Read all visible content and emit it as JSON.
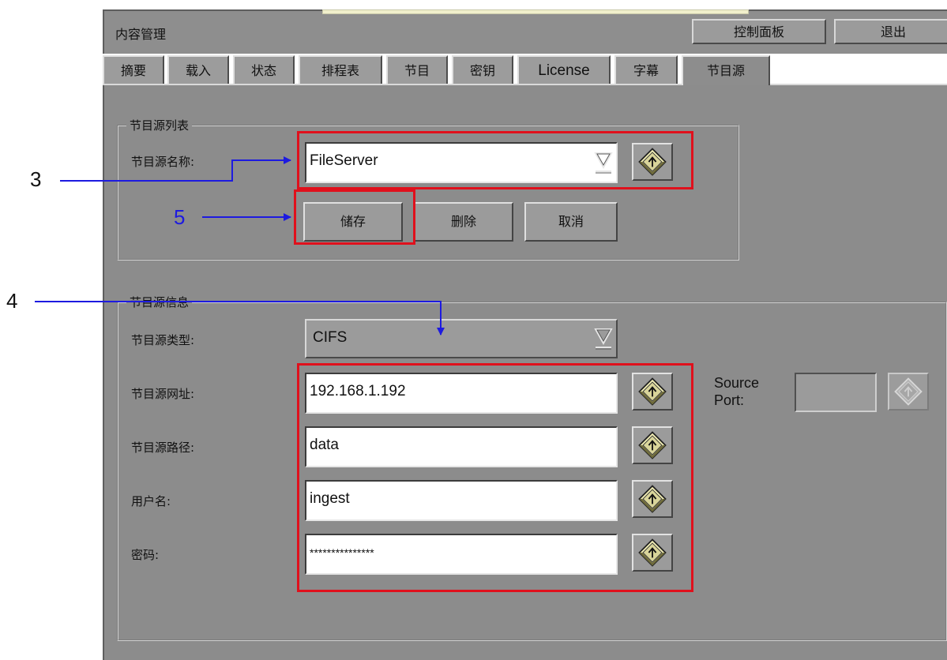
{
  "app": {
    "title": "内容管理"
  },
  "header_buttons": {
    "control_panel": "控制面板",
    "exit": "退出"
  },
  "tabs": [
    {
      "label": "摘要"
    },
    {
      "label": "载入"
    },
    {
      "label": "状态"
    },
    {
      "label": "排程表"
    },
    {
      "label": "节目"
    },
    {
      "label": "密钥"
    },
    {
      "label": "License"
    },
    {
      "label": "字幕"
    },
    {
      "label": "节目源",
      "active": true
    }
  ],
  "source_list": {
    "group_title": "节目源列表",
    "name_label": "节目源名称:",
    "name_value": "FileServer",
    "buttons": {
      "save": "储存",
      "delete": "删除",
      "cancel": "取消"
    }
  },
  "source_info": {
    "group_title": "节目源信息",
    "type_label": "节目源类型:",
    "type_value": "CIFS",
    "address_label": "节目源网址:",
    "address_value": "192.168.1.192",
    "path_label": "节目源路径:",
    "path_value": "data",
    "user_label": "用户名:",
    "user_value": "ingest",
    "password_label": "密码:",
    "password_value": "***************",
    "source_port_label_1": "Source",
    "source_port_label_2": "Port:"
  },
  "annotations": [
    {
      "number": "3"
    },
    {
      "number": "5"
    },
    {
      "number": "4"
    }
  ],
  "colors": {
    "annotation_blue": "#1d1ae0",
    "highlight_red": "#e0101c",
    "panel_gray": "#8c8c8c"
  },
  "icons": {
    "dropdown": "dropdown-triangle-icon",
    "keyboard": "keyboard-diamond-icon"
  }
}
